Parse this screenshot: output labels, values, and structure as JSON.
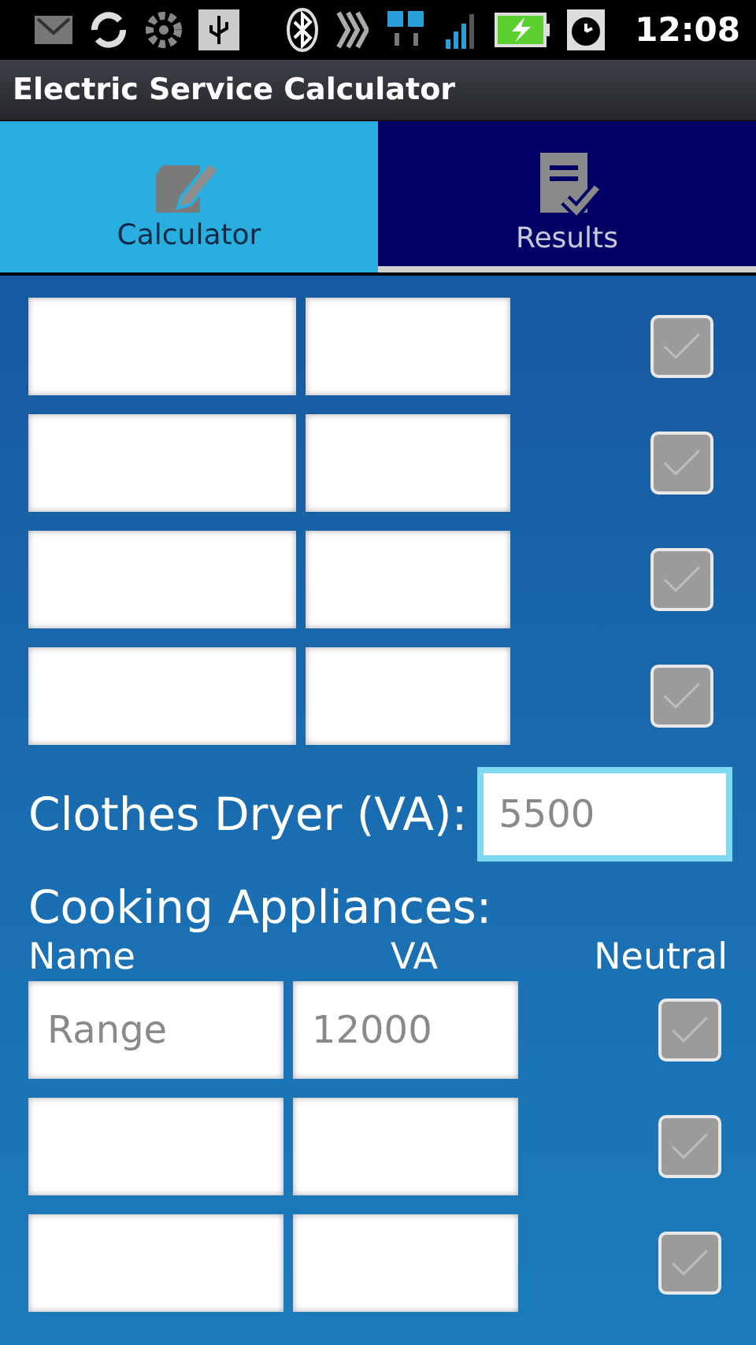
{
  "status_bar": {
    "time": "12:08"
  },
  "app_bar": {
    "title": "Electric Service Calculator"
  },
  "tabs": [
    {
      "label": "Calculator",
      "kind": "edit",
      "selected": true
    },
    {
      "label": "Results",
      "kind": "checklist",
      "selected": false
    }
  ],
  "load_rows": [
    {
      "checked": false
    },
    {
      "checked": false
    },
    {
      "checked": false
    },
    {
      "checked": false
    }
  ],
  "clothes_dryer": {
    "label": "Clothes Dryer (VA):",
    "placeholder": "5500",
    "focused": true
  },
  "cooking": {
    "title": "Cooking Appliances:",
    "columns": [
      "Name",
      "VA",
      "Neutral"
    ],
    "rows": [
      {
        "name_placeholder": "Range",
        "va_placeholder": "12000",
        "checked": false
      },
      {
        "checked": false
      },
      {
        "checked": false
      }
    ]
  }
}
